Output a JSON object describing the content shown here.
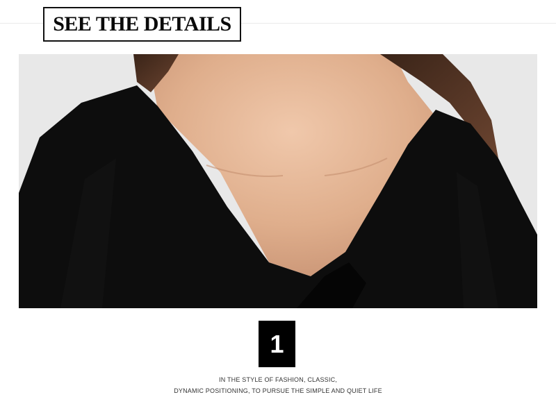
{
  "header": {
    "title": "SEE THE DETAILS"
  },
  "photo": {
    "subject": "model-black-wrap-sweater-neckline"
  },
  "detail": {
    "number": "1",
    "caption_line_1": "IN THE STYLE OF FASHION, CLASSIC,",
    "caption_line_2": "DYNAMIC POSITIONING, TO PURSUE THE SIMPLE AND QUIET LIFE"
  },
  "colors": {
    "background": "#ffffff",
    "badge": "#000000",
    "garment": "#0d0d0d",
    "skin": "#e2b596"
  }
}
